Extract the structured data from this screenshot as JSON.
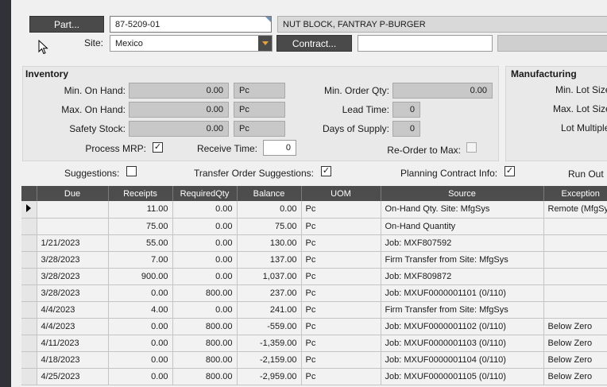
{
  "header": {
    "part_button": "Part...",
    "part_number": "87-5209-01",
    "part_description": "NUT BLOCK, FANTRAY P-BURGER",
    "site_label": "Site:",
    "site_value": "Mexico",
    "contract_button": "Contract...",
    "contract_value": ""
  },
  "inventory": {
    "title": "Inventory",
    "min_on_hand_label": "Min. On Hand:",
    "min_on_hand_value": "0.00",
    "min_on_hand_uom": "Pc",
    "max_on_hand_label": "Max. On Hand:",
    "max_on_hand_value": "0.00",
    "max_on_hand_uom": "Pc",
    "safety_stock_label": "Safety Stock:",
    "safety_stock_value": "0.00",
    "safety_stock_uom": "Pc",
    "min_order_qty_label": "Min. Order Qty:",
    "min_order_qty_value": "0.00",
    "lead_time_label": "Lead Time:",
    "lead_time_value": "0",
    "days_of_supply_label": "Days of Supply:",
    "days_of_supply_value": "0",
    "process_mrp_label": "Process MRP:",
    "process_mrp_checked": true,
    "receive_time_label": "Receive Time:",
    "receive_time_value": "0",
    "reorder_to_max_label": "Re-Order to Max:",
    "reorder_to_max_checked": false
  },
  "manufacturing": {
    "title": "Manufacturing",
    "min_lot_size_label": "Min. Lot Size",
    "max_lot_size_label": "Max. Lot Size",
    "lot_multiple_label": "Lot Multiple"
  },
  "options": {
    "suggestions_label": "Suggestions:",
    "suggestions_checked": false,
    "transfer_order_label": "Transfer Order Suggestions:",
    "transfer_order_checked": true,
    "planning_contract_label": "Planning Contract Info:",
    "planning_contract_checked": true,
    "run_out_label": "Run Out"
  },
  "grid": {
    "columns": [
      "Due",
      "Receipts",
      "RequiredQty",
      "Balance",
      "UOM",
      "Source",
      "Exception"
    ],
    "rows": [
      {
        "due": "",
        "receipts": "11.00",
        "required": "0.00",
        "balance": "0.00",
        "uom": "Pc",
        "source": "On-Hand Qty. Site: MfgSys",
        "exception": "Remote (MfgSys"
      },
      {
        "due": "",
        "receipts": "75.00",
        "required": "0.00",
        "balance": "75.00",
        "uom": "Pc",
        "source": "On-Hand Quantity",
        "exception": ""
      },
      {
        "due": "1/21/2023",
        "receipts": "55.00",
        "required": "0.00",
        "balance": "130.00",
        "uom": "Pc",
        "source": "Job: MXF807592",
        "exception": ""
      },
      {
        "due": "3/28/2023",
        "receipts": "7.00",
        "required": "0.00",
        "balance": "137.00",
        "uom": "Pc",
        "source": "Firm Transfer from Site: MfgSys",
        "exception": ""
      },
      {
        "due": "3/28/2023",
        "receipts": "900.00",
        "required": "0.00",
        "balance": "1,037.00",
        "uom": "Pc",
        "source": "Job: MXF809872",
        "exception": ""
      },
      {
        "due": "3/28/2023",
        "receipts": "0.00",
        "required": "800.00",
        "balance": "237.00",
        "uom": "Pc",
        "source": "Job: MXUF0000001101 (0/110)",
        "exception": ""
      },
      {
        "due": "4/4/2023",
        "receipts": "4.00",
        "required": "0.00",
        "balance": "241.00",
        "uom": "Pc",
        "source": "Firm Transfer from Site: MfgSys",
        "exception": ""
      },
      {
        "due": "4/4/2023",
        "receipts": "0.00",
        "required": "800.00",
        "balance": "-559.00",
        "uom": "Pc",
        "source": "Job: MXUF0000001102 (0/110)",
        "exception": "Below Zero"
      },
      {
        "due": "4/11/2023",
        "receipts": "0.00",
        "required": "800.00",
        "balance": "-1,359.00",
        "uom": "Pc",
        "source": "Job: MXUF0000001103 (0/110)",
        "exception": "Below Zero"
      },
      {
        "due": "4/18/2023",
        "receipts": "0.00",
        "required": "800.00",
        "balance": "-2,159.00",
        "uom": "Pc",
        "source": "Job: MXUF0000001104 (0/110)",
        "exception": "Below Zero"
      },
      {
        "due": "4/25/2023",
        "receipts": "0.00",
        "required": "800.00",
        "balance": "-2,959.00",
        "uom": "Pc",
        "source": "Job: MXUF0000001105 (0/110)",
        "exception": "Below Zero"
      }
    ]
  }
}
